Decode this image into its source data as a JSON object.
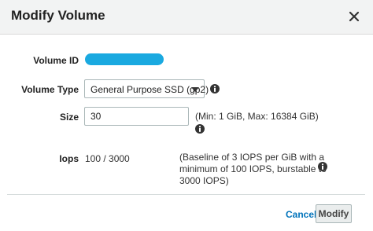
{
  "dialog": {
    "title": "Modify Volume",
    "close_icon": "close-icon"
  },
  "form": {
    "volume_id": {
      "label": "Volume ID",
      "value_redacted": true
    },
    "volume_type": {
      "label": "Volume Type",
      "selected": "General Purpose SSD (gp2)",
      "caret_icon": "chevron-down-icon",
      "info_icon": "info-icon"
    },
    "size": {
      "label": "Size",
      "value": "30",
      "hint": "(Min: 1 GiB, Max: 16384 GiB)",
      "info_icon": "info-icon"
    },
    "iops": {
      "label": "Iops",
      "value": "100 / 3000",
      "hint_lines": [
        "(Baseline of 3 IOPS per GiB with a",
        "minimum of 100 IOPS, burstable to",
        "3000 IOPS)"
      ],
      "info_icon": "info-icon"
    }
  },
  "footer": {
    "cancel_label": "Cancel",
    "modify_label": "Modify"
  },
  "colors": {
    "header_bg": "#f2f3f3",
    "link": "#0073bb",
    "redaction": "#1aa9e0",
    "button_bg": "#eaeded"
  }
}
